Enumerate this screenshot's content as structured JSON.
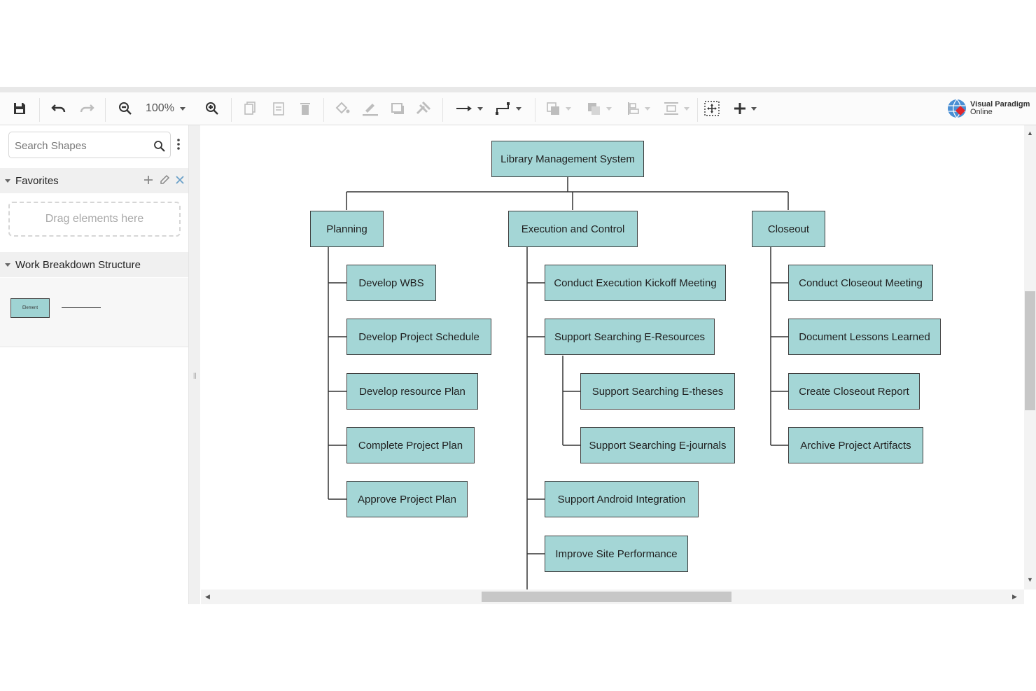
{
  "toolbar": {
    "zoom_level": "100%",
    "icons": [
      "save-icon",
      "undo-icon",
      "redo-icon",
      "zoom-out-icon",
      "zoom-in-icon",
      "copy-icon",
      "paste-icon",
      "delete-icon",
      "fill-color-icon",
      "line-color-icon",
      "shadow-icon",
      "format-painter-icon",
      "connector-style-icon",
      "waypoint-style-icon",
      "to-front-icon",
      "to-back-icon",
      "align-icon",
      "distribute-icon",
      "select-all-icon",
      "insert-icon"
    ]
  },
  "brand": {
    "line1": "Visual Paradigm",
    "line2": "Online"
  },
  "sidebar": {
    "search_placeholder": "Search Shapes",
    "favorites_title": "Favorites",
    "drop_text": "Drag elements here",
    "section_title": "Work Breakdown Structure",
    "shape_label": "Element"
  },
  "diagram": {
    "root": "Library Management System",
    "planning": {
      "label": "Planning",
      "children": [
        "Develop WBS",
        "Develop Project Schedule",
        "Develop resource Plan",
        "Complete Project Plan",
        "Approve Project Plan"
      ]
    },
    "execution": {
      "label": "Execution and Control",
      "kickoff": "Conduct Execution Kickoff Meeting",
      "eresources": {
        "label": "Support Searching E-Resources",
        "children": [
          "Support Searching E-theses",
          "Support Searching E-journals"
        ]
      },
      "android": "Support Android Integration",
      "performance": "Improve Site Performance"
    },
    "closeout": {
      "label": "Closeout",
      "children": [
        "Conduct Closeout Meeting",
        "Document Lessons Learned",
        "Create Closeout Report",
        "Archive Project Artifacts"
      ]
    }
  },
  "colors": {
    "node_fill": "#a4d6d6",
    "node_border": "#3f3f3f",
    "accent": "#e0242b"
  }
}
